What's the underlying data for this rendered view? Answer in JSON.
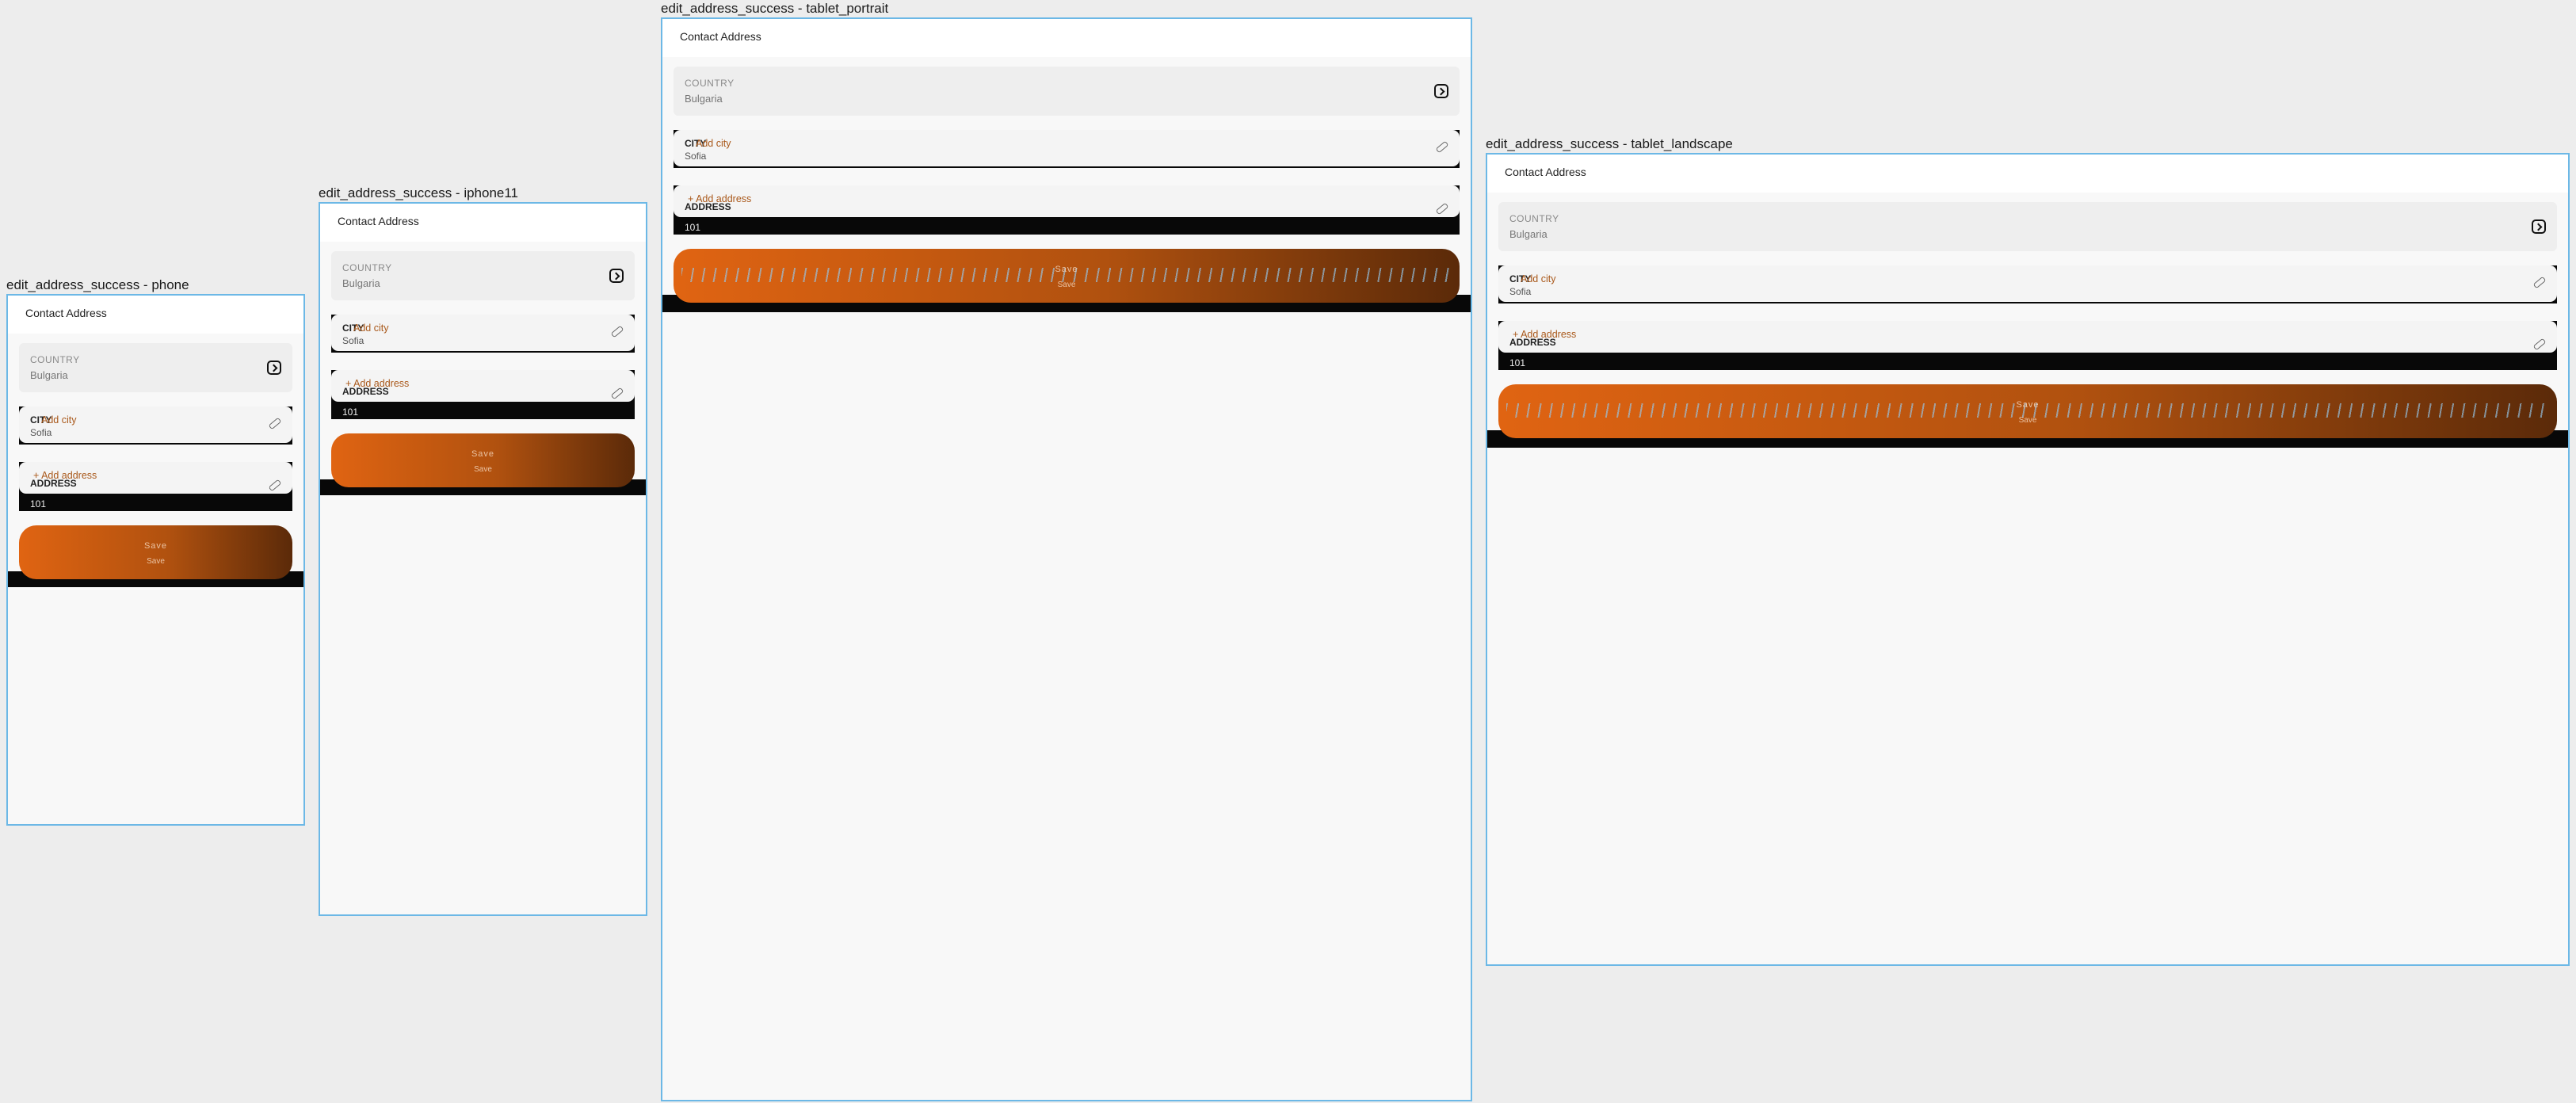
{
  "frames": [
    {
      "key": "phone",
      "title": "edit_address_success - phone"
    },
    {
      "key": "iphone11",
      "title": "edit_address_success - iphone11"
    },
    {
      "key": "tablet_portrait",
      "title": "edit_address_success - tablet_portrait"
    },
    {
      "key": "tablet_landscape",
      "title": "edit_address_success - tablet_landscape"
    }
  ],
  "screen": {
    "title": "Contact Address",
    "country": {
      "label": "COUNTRY",
      "value": "Bulgaria",
      "icon": "chevron-right-box-icon"
    },
    "city": {
      "label": "CITY",
      "add": "Add city",
      "value": "Sofia",
      "icon": "pencil-icon"
    },
    "address": {
      "label": "ADDRESS",
      "add": "+ Add address",
      "value": "101",
      "icon": "pencil-icon"
    },
    "save": {
      "label": "Save",
      "sub": "Save"
    }
  },
  "colors": {
    "accent_start": "#e06412",
    "accent_end": "#5b2a09",
    "frame_border": "#6cb8e6",
    "background": "#f8f8f8"
  }
}
